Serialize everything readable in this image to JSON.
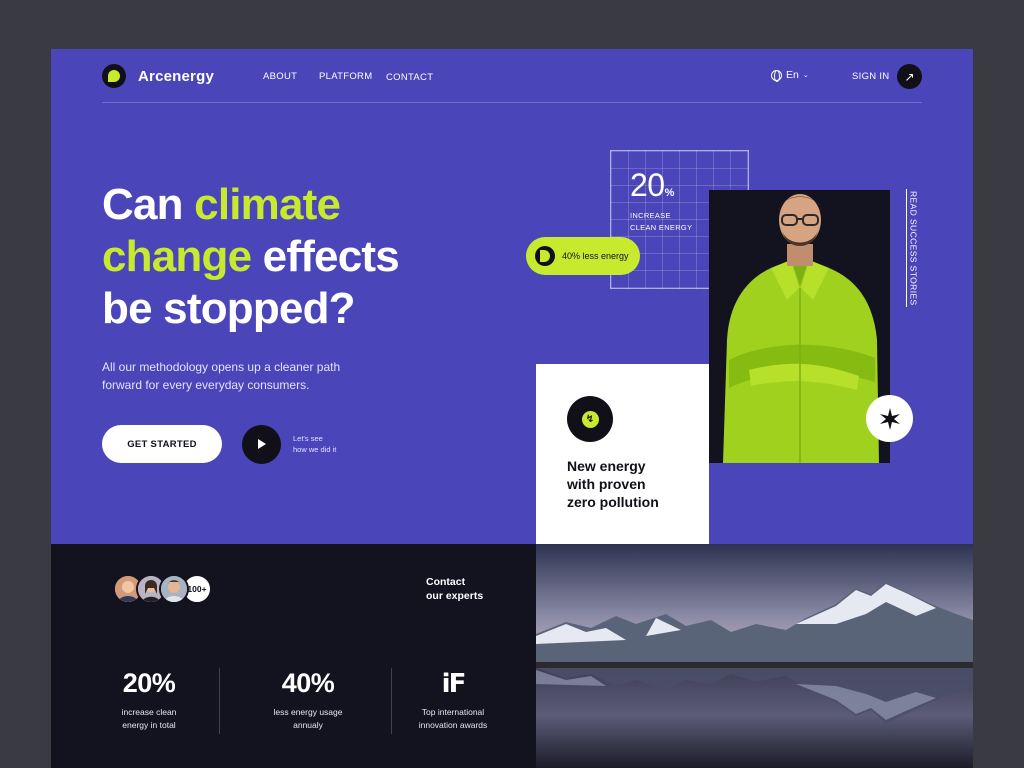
{
  "brand": {
    "name": "Arcenergy"
  },
  "nav": {
    "links": [
      "ABOUT",
      "PLATFORM",
      "CONTACT"
    ],
    "language": "En",
    "sign_in": "SIGN IN"
  },
  "hero": {
    "headline_1": "Can ",
    "headline_1_hl": "climate",
    "headline_2_hl": "change",
    "headline_2": " effects",
    "headline_3": "be stopped?",
    "subtext": "All our methodology opens up a cleaner path forward for every everyday consumers.",
    "cta_label": "GET STARTED",
    "video_label_1": "Let's see",
    "video_label_2": "how we did it"
  },
  "stat_card": {
    "value": "20",
    "unit": "%",
    "caption_1": "INCREASE",
    "caption_2": "CLEAN ENERGY"
  },
  "pill": {
    "label": "40% less energy"
  },
  "side": {
    "stories": "READ SUCCESS STORIES"
  },
  "feature_card": {
    "line_1": "New energy",
    "line_2": "with proven",
    "line_3": "zero pollution"
  },
  "experts": {
    "count_badge": "100+",
    "contact_1": "Contact",
    "contact_2": "our experts"
  },
  "stats": [
    {
      "value": "20%",
      "label_1": "increase clean",
      "label_2": "energy in total"
    },
    {
      "value": "40%",
      "label_1": "less energy usage",
      "label_2": "annualy"
    },
    {
      "value": "iF",
      "label_1": "Top international",
      "label_2": "innovation awards"
    }
  ],
  "colors": {
    "primary": "#4a45b8",
    "accent": "#c8ea2e",
    "dark": "#13121f"
  }
}
